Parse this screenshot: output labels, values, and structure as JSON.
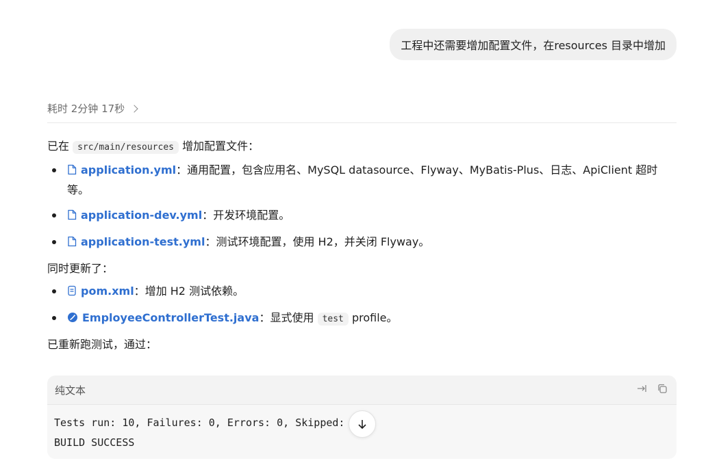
{
  "user_message": "工程中还需要增加配置文件，在resources 目录中增加",
  "thinking": {
    "label": "耗时 2分钟 17秒"
  },
  "reply": {
    "intro_prefix": "已在",
    "intro_path": "src/main/resources",
    "intro_suffix": "增加配置文件：",
    "config_files": [
      {
        "icon": "file-icon",
        "name": "application.yml",
        "desc": "通用配置，包含应用名、MySQL datasource、Flyway、MyBatis-Plus、日志、ApiClient 超时等。"
      },
      {
        "icon": "file-icon",
        "name": "application-dev.yml",
        "desc": "开发环境配置。"
      },
      {
        "icon": "file-icon",
        "name": "application-test.yml",
        "desc": "测试环境配置，使用 H2，并关闭 Flyway。"
      }
    ],
    "also_updated": "同时更新了：",
    "updated_files": [
      {
        "icon": "xml-file-icon",
        "name": "pom.xml",
        "desc": "增加 H2 测试依赖。"
      },
      {
        "icon": "java-file-icon",
        "name": "EmployeeControllerTest.java",
        "desc_prefix": "显式使用",
        "desc_code": "test",
        "desc_suffix": "profile。"
      }
    ],
    "rerun": "已重新跑测试，通过："
  },
  "code_block": {
    "language_label": "纯文本",
    "line1": "Tests run: 10, Failures: 0, Errors: 0, Skipped: 0",
    "line2": "BUILD SUCCESS"
  },
  "colors": {
    "link": "#2f6fd0",
    "bubble": "#f0f0f0",
    "code_bg": "#f7f7f7"
  }
}
